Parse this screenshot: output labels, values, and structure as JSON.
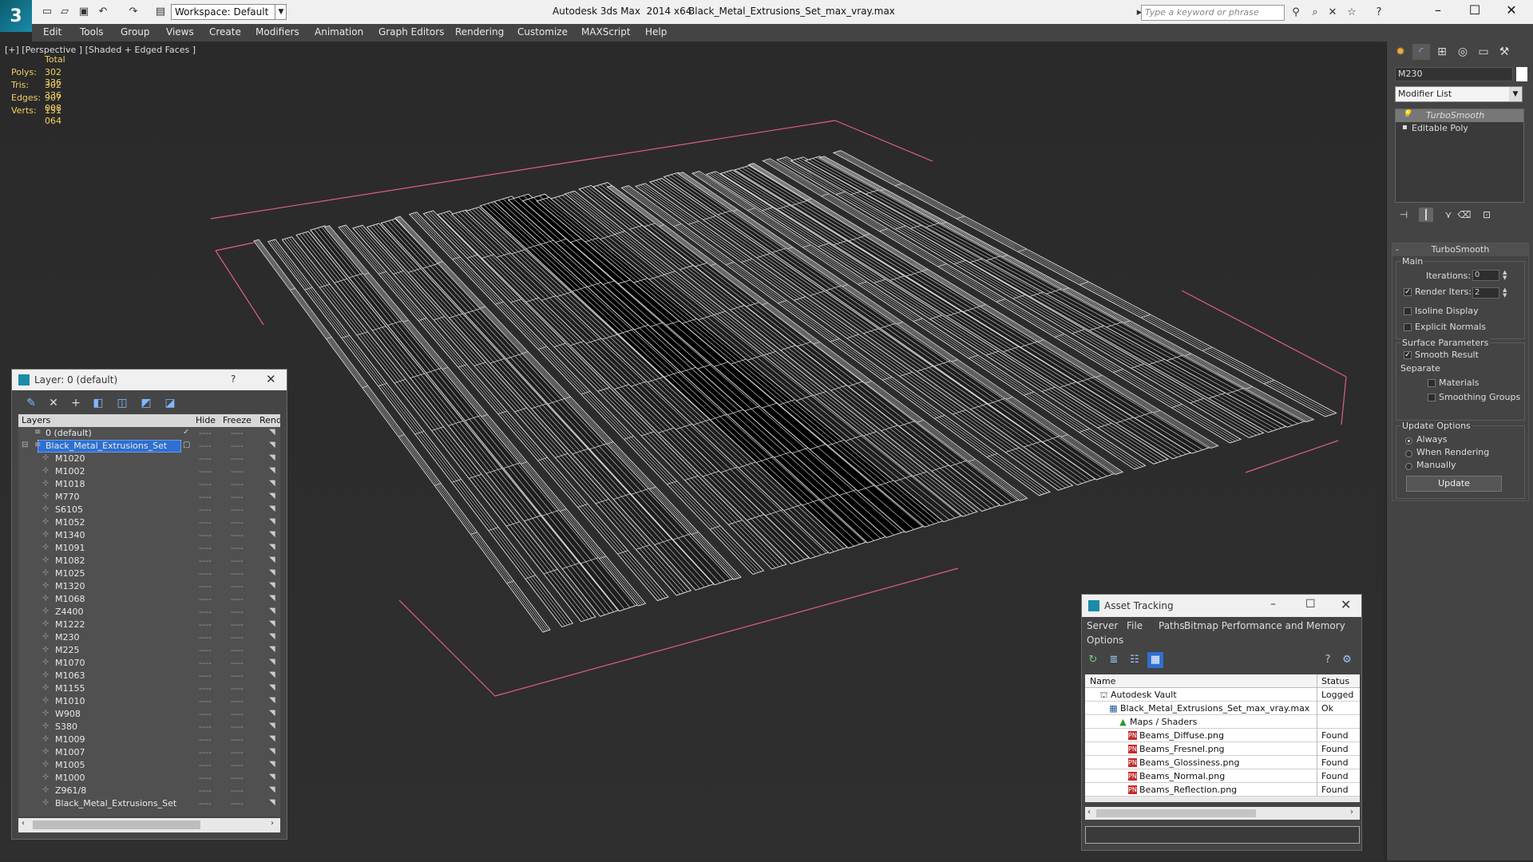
{
  "titlebar": {
    "workspace": "Workspace: Default",
    "app_title": "Autodesk 3ds Max  2014 x64",
    "file_name": "Black_Metal_Extrusions_Set_max_vray.max",
    "search_placeholder": "Type a keyword or phrase"
  },
  "menu": [
    "Edit",
    "Tools",
    "Group",
    "Views",
    "Create",
    "Modifiers",
    "Animation",
    "Graph Editors",
    "Rendering",
    "Customize",
    "MAXScript",
    "Help"
  ],
  "viewport": {
    "label": "[+] [Perspective ] [Shaded + Edged Faces ]",
    "stats": {
      "total_label": "Total",
      "rows": [
        {
          "k": "Polys:",
          "v": "302 336"
        },
        {
          "k": "Tris:",
          "v": "302 336"
        },
        {
          "k": "Edges:",
          "v": "907 008"
        },
        {
          "k": "Verts:",
          "v": "151 064"
        }
      ]
    }
  },
  "layer_panel": {
    "title": "Layer: 0 (default)",
    "help": "?",
    "columns": [
      "Layers",
      "Hide",
      "Freeze",
      "Rend"
    ],
    "default_layer": "0 (default)",
    "selected_layer": "Black_Metal_Extrusions_Set",
    "objects": [
      "M1020",
      "M1002",
      "M1018",
      "M770",
      "S6105",
      "M1052",
      "M1340",
      "M1091",
      "M1082",
      "M1025",
      "M1320",
      "M1068",
      "Z4400",
      "M1222",
      "M230",
      "M225",
      "M1070",
      "M1063",
      "M1155",
      "M1010",
      "W908",
      "S380",
      "M1009",
      "M1007",
      "M1005",
      "M1000",
      "Z961/8",
      "Black_Metal_Extrusions_Set"
    ],
    "dash": "----"
  },
  "asset_tracking": {
    "title": "Asset Tracking",
    "menu": [
      "Server",
      "File",
      "Paths",
      "Bitmap Performance and Memory",
      "Options"
    ],
    "columns": [
      "Name",
      "Status"
    ],
    "rows": [
      {
        "name": "Autodesk Vault",
        "status": "Logged O",
        "indent": 1,
        "icon": "vault"
      },
      {
        "name": "Black_Metal_Extrusions_Set_max_vray.max",
        "status": "Ok",
        "indent": 2,
        "icon": "max"
      },
      {
        "name": "Maps / Shaders",
        "status": "",
        "indent": 3,
        "icon": "folder"
      },
      {
        "name": "Beams_Diffuse.png",
        "status": "Found",
        "indent": 4,
        "icon": "png"
      },
      {
        "name": "Beams_Fresnel.png",
        "status": "Found",
        "indent": 4,
        "icon": "png"
      },
      {
        "name": "Beams_Glossiness.png",
        "status": "Found",
        "indent": 4,
        "icon": "png"
      },
      {
        "name": "Beams_Normal.png",
        "status": "Found",
        "indent": 4,
        "icon": "png"
      },
      {
        "name": "Beams_Reflection.png",
        "status": "Found",
        "indent": 4,
        "icon": "png"
      }
    ],
    "png_badge": "PNG"
  },
  "command_panel": {
    "object_name": "M230",
    "modifier_list": "Modifier List",
    "stack": [
      "TurboSmooth",
      "Editable Poly"
    ],
    "rollout_title": "TurboSmooth",
    "main_label": "Main",
    "iterations_label": "Iterations:",
    "iterations_value": "0",
    "render_iters_label": "Render Iters:",
    "render_iters_value": "2",
    "isoline_label": "Isoline Display",
    "explicit_normals_label": "Explicit Normals",
    "surface_params_label": "Surface Parameters",
    "smooth_result_label": "Smooth Result",
    "separate_label": "Separate",
    "materials_label": "Materials",
    "smoothing_groups_label": "Smoothing Groups",
    "update_options_label": "Update Options",
    "always_label": "Always",
    "when_rendering_label": "When Rendering",
    "manually_label": "Manually",
    "update_button": "Update"
  }
}
